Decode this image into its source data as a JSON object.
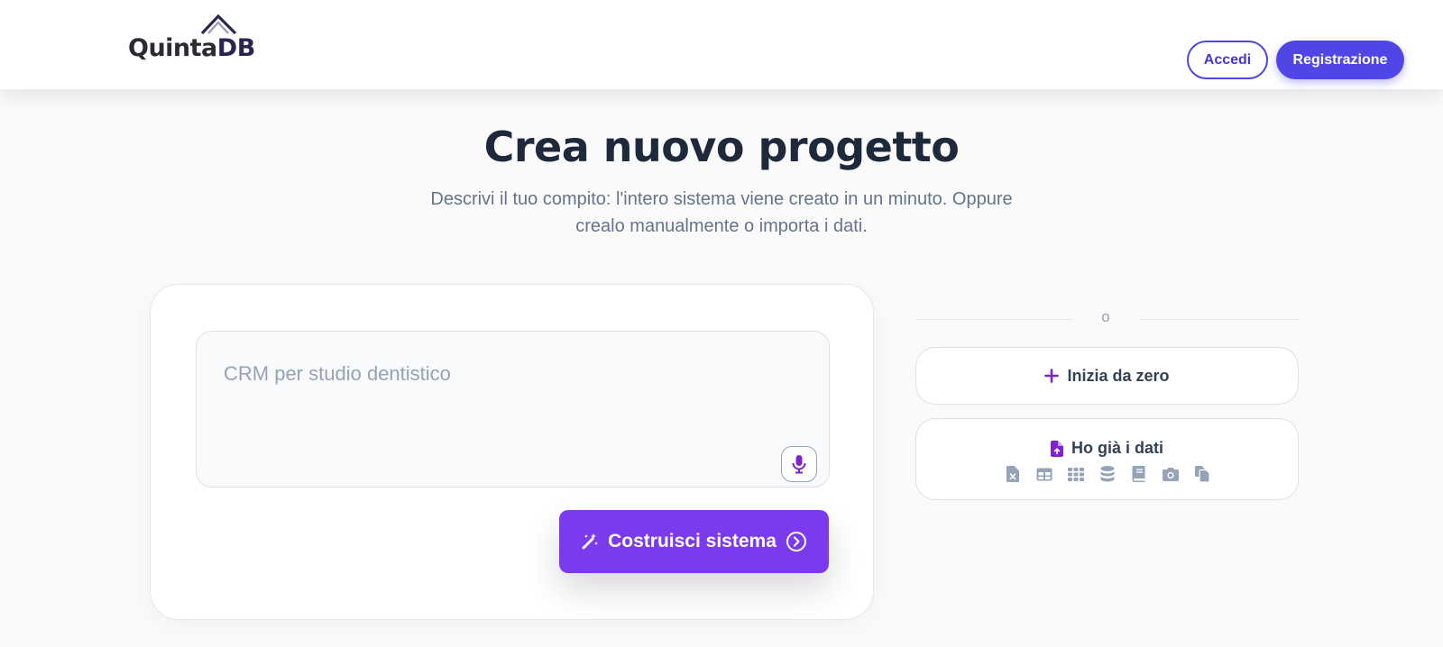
{
  "app": {
    "logo_text_part1": "Quinta",
    "logo_text_part2": "DB"
  },
  "header": {
    "login_label": "Accedi",
    "register_label": "Registrazione"
  },
  "main": {
    "title": "Crea nuovo progetto",
    "subtitle": "Descrivi il tuo compito: l'intero sistema viene creato in un minuto. Oppure crealo manualmente o importa i dati."
  },
  "prompt": {
    "placeholder": "CRM per studio dentistico",
    "value": "",
    "mic_icon": "microphone-icon",
    "build_label": "Costruisci sistema",
    "build_icons": [
      "magic-wand-icon",
      "chevron-right-circle-icon"
    ]
  },
  "options": {
    "divider_label": "o",
    "scratch_label": "Inizia da zero",
    "scratch_icon": "plus-icon",
    "import_label": "Ho già i dati",
    "import_icon": "file-upload-icon",
    "format_icons": [
      "excel-file-icon",
      "table-icon",
      "grid-icon",
      "database-icon",
      "book-icon",
      "camera-icon",
      "copy-files-icon"
    ]
  },
  "colors": {
    "brand_indigo": "#4f46e5",
    "build_purple": "#7c3aed",
    "icon_purple": "#7e22ce",
    "icon_gray": "#94a3b8",
    "title": "#1e293b",
    "subtitle": "#64748b"
  }
}
